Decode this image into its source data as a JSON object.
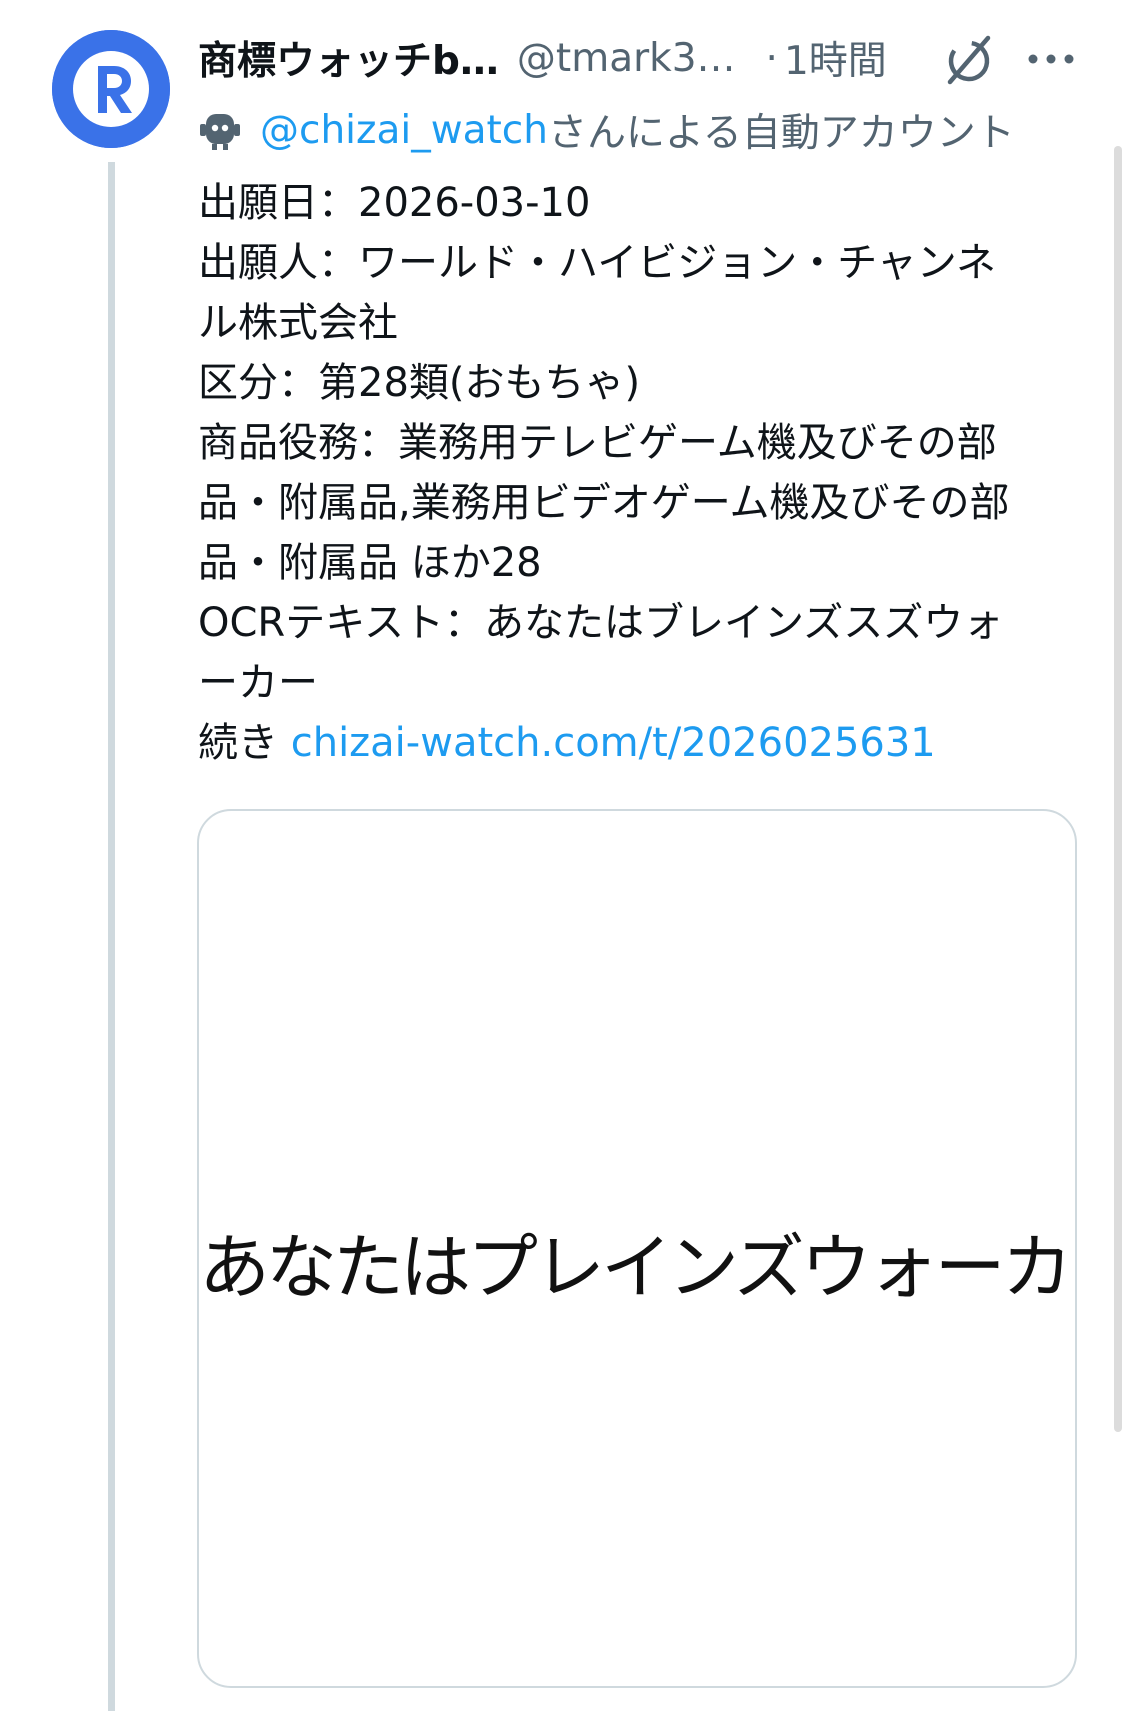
{
  "tweet": {
    "display_name": "商標ウォッチb…",
    "handle": "@tmark3…",
    "separator": "·",
    "time": "1時間",
    "automated_mention": "@chizai_watch",
    "automated_suffix": "さんによる自動アカウント",
    "body_lines": [
      "出願日：2026-03-10",
      "出願人：ワールド・ハイビジョン・チャンネ",
      "ル株式会社",
      "区分：第28類(おもちゃ)",
      "商品役務：業務用テレビゲーム機及びその部",
      "品・附属品,業務用ビデオゲーム機及びその部",
      "品・附属品 ほか28",
      "OCRテキスト：あなたはブレインズスズウォ",
      "ーカー"
    ],
    "continue_prefix": "続き ",
    "continue_link": "chizai-watch.com/t/2026025631",
    "media_text": "あなたはプレインズウォーカー"
  },
  "icons": {
    "avatar": "registered-trademark-icon",
    "grok": "grok-icon",
    "more": "more-icon",
    "bot": "bot-icon"
  },
  "colors": {
    "avatar_bg": "#3a72e8",
    "link": "#1d9bf0",
    "secondary_text": "#536471",
    "primary_text": "#0f1419",
    "thread_line": "#cfd9de"
  }
}
